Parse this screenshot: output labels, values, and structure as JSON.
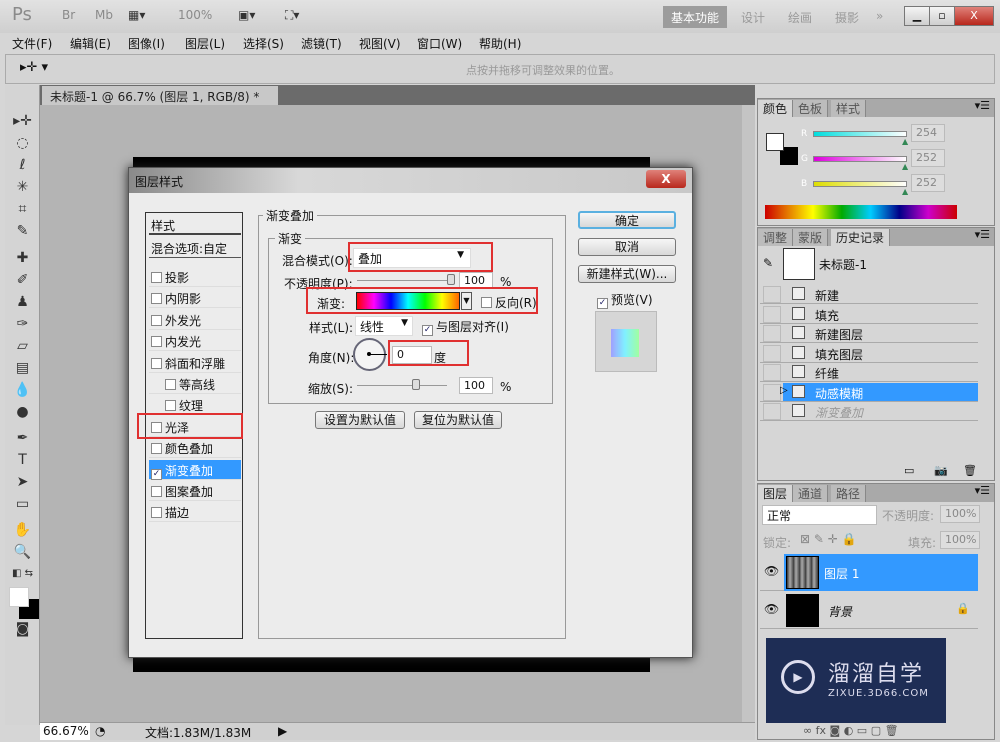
{
  "app": {
    "logo": "Ps",
    "bridge": "Br",
    "minibridge": "Mb",
    "zoom": "100%",
    "workspaces": [
      "基本功能",
      "设计",
      "绘画",
      "摄影"
    ],
    "more": "»",
    "window_buttons": [
      "minimize",
      "restore",
      "close"
    ]
  },
  "menu": [
    "文件(F)",
    "编辑(E)",
    "图像(I)",
    "图层(L)",
    "选择(S)",
    "滤镜(T)",
    "视图(V)",
    "窗口(W)",
    "帮助(H)"
  ],
  "options": {
    "hint": "点按并拖移可调整效果的位置。"
  },
  "document": {
    "tab": "未标题-1 @ 66.7% (图层 1, RGB/8) *"
  },
  "status": {
    "zoom": "66.67%",
    "doc": "文档:1.83M/1.83M"
  },
  "dialog": {
    "title": "图层样式",
    "styles_header": "样式",
    "blend_options": "混合选项:自定",
    "styles": [
      {
        "label": "投影",
        "checked": false,
        "indent": false
      },
      {
        "label": "内阴影",
        "checked": false,
        "indent": false
      },
      {
        "label": "外发光",
        "checked": false,
        "indent": false
      },
      {
        "label": "内发光",
        "checked": false,
        "indent": false
      },
      {
        "label": "斜面和浮雕",
        "checked": false,
        "indent": false
      },
      {
        "label": "等高线",
        "checked": false,
        "indent": true
      },
      {
        "label": "纹理",
        "checked": false,
        "indent": true
      },
      {
        "label": "光泽",
        "checked": false,
        "indent": false
      },
      {
        "label": "颜色叠加",
        "checked": false,
        "indent": false
      },
      {
        "label": "渐变叠加",
        "checked": true,
        "indent": false,
        "selected": true
      },
      {
        "label": "图案叠加",
        "checked": false,
        "indent": false
      },
      {
        "label": "描边",
        "checked": false,
        "indent": false
      }
    ],
    "section_title": "渐变叠加",
    "group_title": "渐变",
    "blend_mode_label": "混合模式(O):",
    "blend_mode": "叠加",
    "opacity_label": "不透明度(P):",
    "opacity": "100",
    "opacity_unit": "%",
    "gradient_label": "渐变:",
    "reverse_label": "反向(R)",
    "reverse": false,
    "style_label": "样式(L):",
    "style": "线性",
    "align_label": "与图层对齐(I)",
    "align": true,
    "angle_label": "角度(N):",
    "angle": "0",
    "angle_unit": "度",
    "scale_label": "缩放(S):",
    "scale": "100",
    "scale_unit": "%",
    "make_default": "设置为默认值",
    "reset_default": "复位为默认值",
    "ok": "确定",
    "cancel": "取消",
    "new_style": "新建样式(W)...",
    "preview_label": "预览(V)",
    "preview": true
  },
  "color_panel": {
    "tabs": [
      "颜色",
      "色板",
      "样式"
    ],
    "channels": [
      {
        "label": "R",
        "value": "254"
      },
      {
        "label": "G",
        "value": "252"
      },
      {
        "label": "B",
        "value": "252"
      }
    ]
  },
  "history_panel": {
    "tabs": [
      "调整",
      "蒙版",
      "历史记录"
    ],
    "snapshot": "未标题-1",
    "items": [
      {
        "label": "新建"
      },
      {
        "label": "填充"
      },
      {
        "label": "新建图层"
      },
      {
        "label": "填充图层"
      },
      {
        "label": "纤维"
      },
      {
        "label": "动感模糊",
        "selected": true
      },
      {
        "label": "渐变叠加",
        "dimmed": true
      }
    ]
  },
  "layers_panel": {
    "tabs": [
      "图层",
      "通道",
      "路径"
    ],
    "blend": "正常",
    "opacity_label": "不透明度:",
    "opacity": "100%",
    "lock_label": "锁定:",
    "fill_label": "填充:",
    "fill": "100%",
    "layers": [
      {
        "name": "图层 1",
        "selected": true
      },
      {
        "name": "背景",
        "locked": true
      }
    ]
  },
  "watermark": {
    "brand": "溜溜自学",
    "url": "ZIXUE.3D66.COM"
  },
  "colors": {
    "accent": "#3399ff",
    "highlight": "#e03030",
    "watermark_bg": "#1e2d55"
  }
}
